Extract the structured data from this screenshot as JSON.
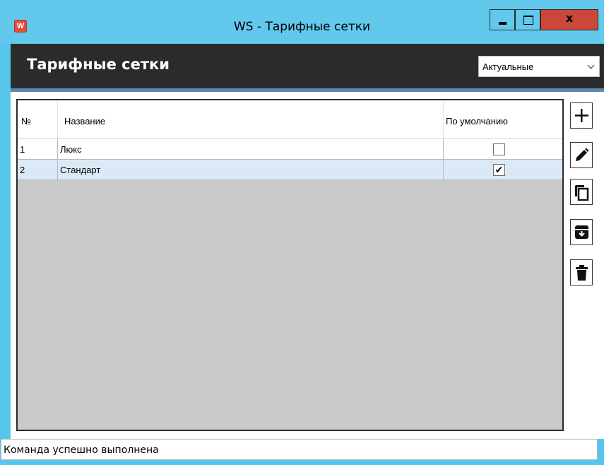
{
  "window": {
    "title": "WS - Тарифные сетки",
    "app_icon_letter": "W",
    "close_label": "x"
  },
  "header": {
    "title": "Тарифные сетки",
    "filter": {
      "selected": "Актуальные"
    }
  },
  "table": {
    "columns": [
      "№",
      "Название",
      "По умолчанию"
    ],
    "rows": [
      {
        "num": "1",
        "name": "Люкс",
        "default": false
      },
      {
        "num": "2",
        "name": "Стандарт",
        "default": true
      }
    ],
    "checked_glyph": "✔"
  },
  "toolbar": {
    "icons": [
      "add-icon",
      "edit-icon",
      "copy-icon",
      "archive-icon",
      "delete-icon"
    ]
  },
  "status": {
    "text": "Команда успешно выполнена"
  },
  "colors": {
    "titlebar": "#62c9ec",
    "header": "#2b2b2b",
    "close_button": "#c9483a",
    "selected_row": "#dbe9f7",
    "grid_empty": "#c9c9c9"
  }
}
